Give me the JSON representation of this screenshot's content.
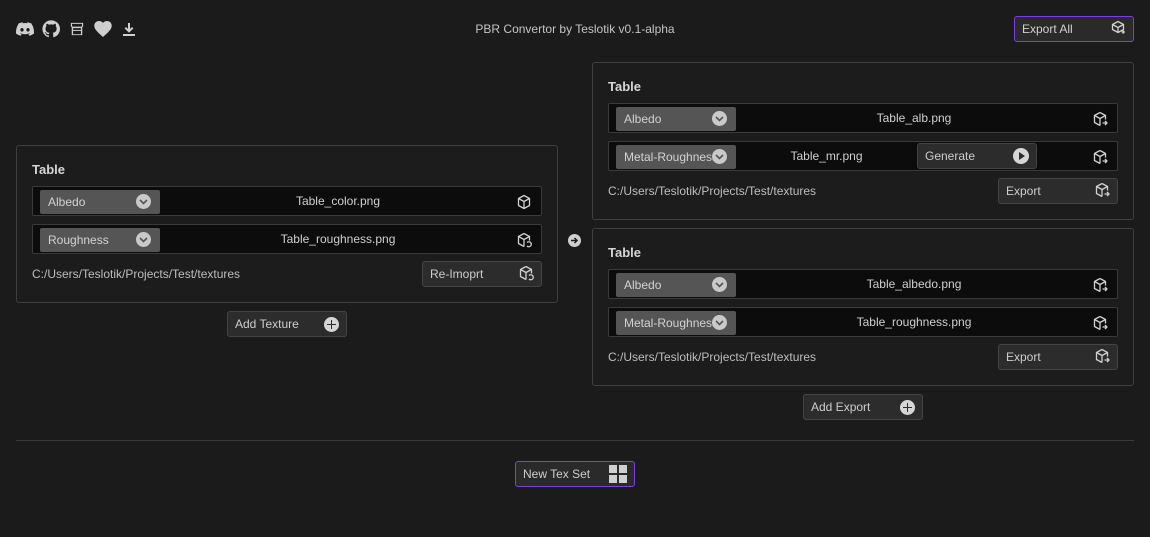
{
  "header": {
    "title": "PBR Convertor by Teslotik v0.1-alpha",
    "export_all_label": "Export All",
    "icons": [
      "discord-icon",
      "github-icon",
      "store-icon",
      "heart-icon",
      "download-icon"
    ]
  },
  "input_set": {
    "title": "Table",
    "rows": [
      {
        "type": "Albedo",
        "file": "Table_color.png"
      },
      {
        "type": "Roughness",
        "file": "Table_roughness.png"
      }
    ],
    "path": "C:/Users/Teslotik/Projects/Test/textures",
    "reimport_label": "Re-Imoprt",
    "add_texture_label": "Add Texture"
  },
  "exports": [
    {
      "title": "Table",
      "rows": [
        {
          "type": "Albedo",
          "file": "Table_alb.png"
        },
        {
          "type": "Metal-Roughness",
          "file": "Table_mr.png",
          "action": "Generate"
        }
      ],
      "path": "C:/Users/Teslotik/Projects/Test/textures",
      "export_label": "Export"
    },
    {
      "title": "Table",
      "rows": [
        {
          "type": "Albedo",
          "file": "Table_albedo.png"
        },
        {
          "type": "Metal-Roughness",
          "file": "Table_roughness.png"
        }
      ],
      "path": "C:/Users/Teslotik/Projects/Test/textures",
      "export_label": "Export"
    }
  ],
  "add_export_label": "Add Export",
  "new_tex_set_label": "New Tex Set",
  "colors": {
    "background": "#1b1b1b",
    "accent": "#7b3fe4",
    "dropdown": "#555555"
  }
}
